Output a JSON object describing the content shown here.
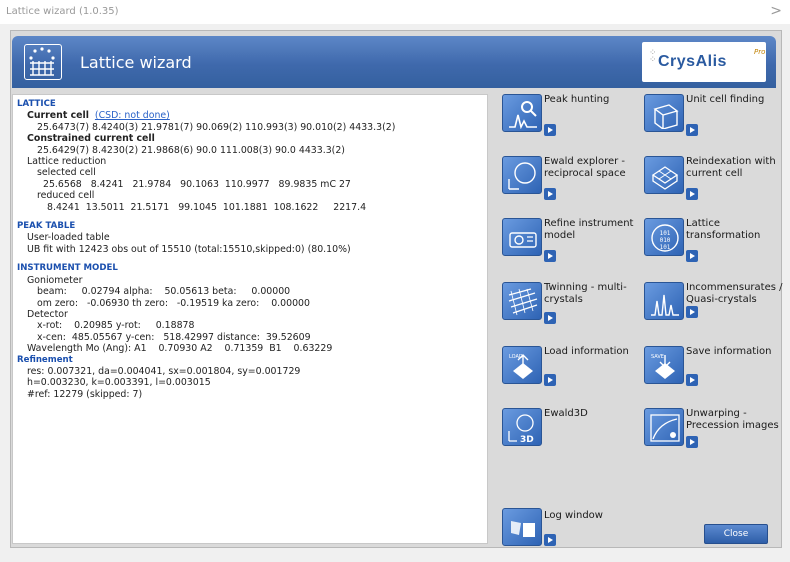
{
  "window": {
    "title": "Lattice wizard (1.0.35)",
    "close_glyph": ">"
  },
  "banner": {
    "title": "Lattice wizard",
    "brand": "CrysAlis",
    "brand_sup": "Pro"
  },
  "info": {
    "lattice": {
      "heading": "LATTICE",
      "current_cell_label": "Current cell",
      "csd_link": "(CSD: not done)",
      "current_cell_values": "25.6473(7) 8.4240(3) 21.9781(7) 90.069(2) 110.993(3) 90.010(2) 4433.3(2)",
      "constrained_label": "Constrained current cell",
      "constrained_values": "25.6429(7) 8.4230(2) 21.9868(6) 90.0 111.008(3) 90.0 4433.3(2)",
      "reduction_label": "Lattice reduction",
      "selected_label": "selected cell",
      "selected_values": "25.6568   8.4241   21.9784   90.1063  110.9977   89.9835 mC 27",
      "reduced_label": "reduced cell",
      "reduced_values": "8.4241  13.5011  21.5171   99.1045  101.1881  108.1622     2217.4"
    },
    "peak_table": {
      "heading": "PEAK TABLE",
      "line1": "User-loaded table",
      "line2": "UB fit with 12423 obs out of 15510 (total:15510,skipped:0) (80.10%)"
    },
    "instrument": {
      "heading": "INSTRUMENT MODEL",
      "goniometer": "Goniometer",
      "beam": "beam:     0.02794 alpha:    50.05613 beta:     0.00000",
      "om_zero": "om zero:   -0.06930 th zero:   -0.19519 ka zero:    0.00000",
      "detector": "Detector",
      "rot": "x-rot:    0.20985 y-rot:     0.18878",
      "cen": "x-cen:  485.05567 y-cen:   518.42997 distance:  39.52609",
      "wavelength": "Wavelength Mo (Ang): A1    0.70930 A2    0.71359  B1    0.63229",
      "refinement": "Refinement",
      "res": "res:   0.007321, da=0.004041, sx=0.001804, sy=0.001729",
      "hkl": "h=0.003230, k=0.003391, l=0.003015",
      "nref": "#ref: 12279 (skipped: 7)"
    }
  },
  "actions": [
    {
      "label": "Peak hunting",
      "icon": "peak-hunting-icon"
    },
    {
      "label": "Unit cell finding",
      "icon": "unit-cell-icon"
    },
    {
      "label": "Ewald explorer - reciprocal space",
      "icon": "ewald-explorer-icon"
    },
    {
      "label": "Reindexation with current cell",
      "icon": "reindexation-icon"
    },
    {
      "label": "Refine instrument model",
      "icon": "refine-instrument-icon"
    },
    {
      "label": "Lattice transformation",
      "icon": "lattice-transformation-icon"
    },
    {
      "label": "Twinning - multi-crystals",
      "icon": "twinning-icon"
    },
    {
      "label": "Incommensurates / Quasi-crystals",
      "icon": "incommensurates-icon"
    },
    {
      "label": "Load information",
      "icon": "load-icon",
      "tag": "LOAD"
    },
    {
      "label": "Save information",
      "icon": "save-icon",
      "tag": "SAVE"
    },
    {
      "label": "Ewald3D",
      "icon": "ewald3d-icon",
      "tag": "3D"
    },
    {
      "label": "Unwarping - Precession images",
      "icon": "unwarping-icon"
    },
    {
      "label": "Log window",
      "icon": "log-window-icon"
    }
  ],
  "close_label": "Close"
}
